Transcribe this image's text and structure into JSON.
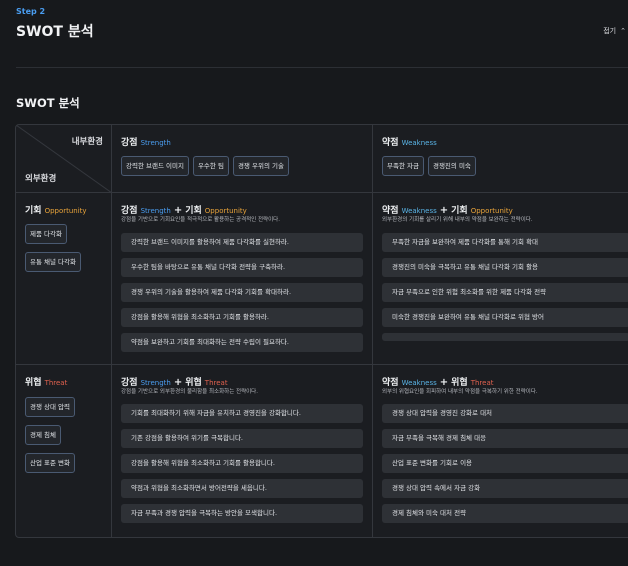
{
  "header": {
    "step": "Step 2",
    "title": "SWOT 분석",
    "fold_label": "접기"
  },
  "section": {
    "title": "SWOT 분석"
  },
  "matrix": {
    "corner": {
      "internal": "내부환경",
      "external": "외부환경"
    },
    "strength": {
      "label": "강점",
      "en": "Strength",
      "chips": [
        "강력한 브랜드 이미지",
        "우수한 팀",
        "경쟁 우위의 기술"
      ]
    },
    "weakness": {
      "label": "약점",
      "en": "Weakness",
      "chips": [
        "부족한 자금",
        "경쟁진의 미숙"
      ]
    },
    "opportunity": {
      "label": "기회",
      "en": "Opportunity",
      "chips": [
        "제품 다각화",
        "유통 채널 다각화"
      ]
    },
    "threat": {
      "label": "위협",
      "en": "Threat",
      "chips": [
        "경쟁 상대 압력",
        "경제 침체",
        "산업 표준 변화"
      ]
    },
    "so": {
      "a": "강점",
      "a_en": "Strength",
      "b": "기회",
      "b_en": "Opportunity",
      "desc": "강점을 기반으로 기회요인을 적극적으로 활용하는 공격적인 전략이다.",
      "items": [
        "강력한 브랜드 이미지를 활용하여 제품 다각화를 실현하라.",
        "우수한 팀을 바탕으로 유통 채널 다각화 전략을 구축하라.",
        "경쟁 우위의 기술을 활용하여 제품 다각화 기회를 확대하라.",
        "강점을 활용해 위협을 최소화하고 기회를 활용하라.",
        "약점을 보완하고 기회를 최대화하는 전략 수립이 필요하다."
      ]
    },
    "wo": {
      "a": "약점",
      "a_en": "Weakness",
      "b": "기회",
      "b_en": "Opportunity",
      "desc": "외부환경의 기회를 살리기 위해 내부의 약점을 보완하는 전략이다.",
      "items": [
        "부족한 자금을 보완하여 제품 다각화를 통해 기회 확대",
        "경쟁진의 미숙을 극복하고 유통 채널 다각화 기회 활용",
        "자금 부족으로 인한 위험 최소화를 위한 제품 다각화 전략",
        "미숙한 경쟁진을 보완하여 유통 채널 다각화로 위협 방어",
        ""
      ]
    },
    "st": {
      "a": "강점",
      "a_en": "Strength",
      "b": "위협",
      "b_en": "Threat",
      "desc": "강점을 기반으로 외부환경의 불리함을 최소화하는 전략이다.",
      "items": [
        "기회를 최대화하기 위해 자금을 유치하고 경영진을 강화합니다.",
        "기존 강점을 활용하여 위기를 극복합니다.",
        "강점을 활용해 위협을 최소화하고 기회를 활용합니다.",
        "약점과 위협을 최소화하면서 방어전략을 세웁니다.",
        "자금 부족과 경쟁 압력을 극복하는 방안을 모색합니다."
      ]
    },
    "wt": {
      "a": "약점",
      "a_en": "Weakness",
      "b": "위협",
      "b_en": "Threat",
      "desc": "외부의 위협요인을 회피하여 내부의 약점을 극복하기 위한 전략이다.",
      "items": [
        "경쟁 상대 압력을 경영진 강화로 대처",
        "자금 부족을 극복해 경제 침체 대응",
        "산업 표준 변화를 기회로 이용",
        "경쟁 상대 압력 속에서 자금 강화",
        "경제 침체와 미숙 대처 전략"
      ]
    }
  }
}
